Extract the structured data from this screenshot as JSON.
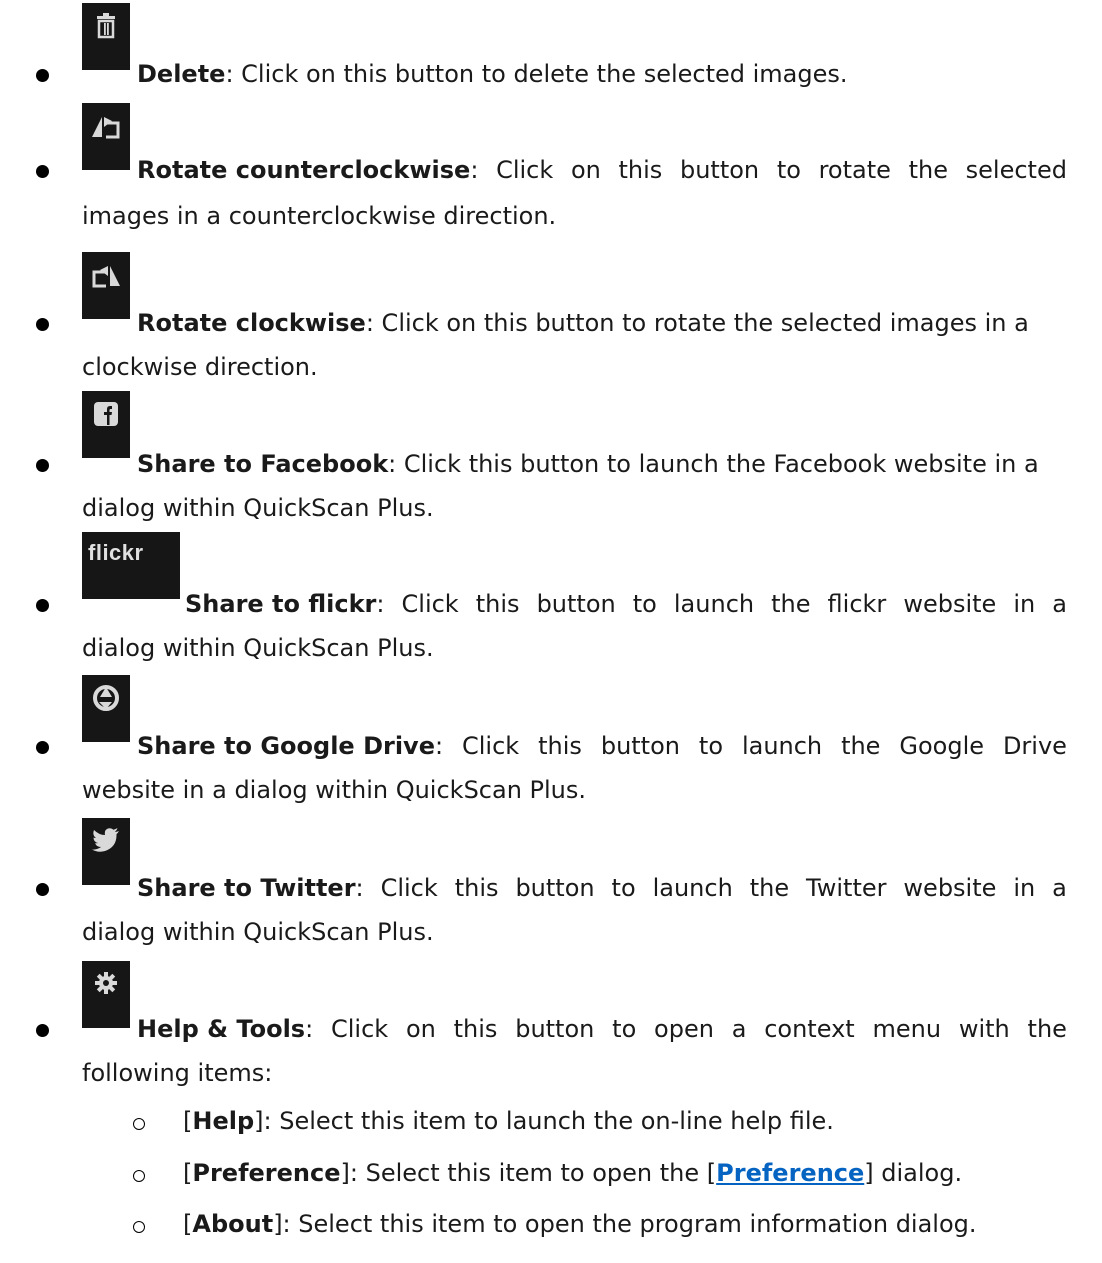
{
  "items": [
    {
      "icon": "trash-icon",
      "title": "Delete",
      "line1": ": Click on this button to delete the selected images.",
      "line2": ""
    },
    {
      "icon": "rotate-counterclockwise-icon",
      "title": "Rotate counterclockwise",
      "line1_words": [
        ":",
        "Click",
        "on",
        "this",
        "button",
        "to",
        "rotate",
        "the",
        "selected"
      ],
      "line2": "images in a counterclockwise direction."
    },
    {
      "icon": "rotate-clockwise-icon",
      "title": "Rotate clockwise",
      "line1": ": Click on this button to rotate the selected images in a",
      "line2": "clockwise direction."
    },
    {
      "icon": "facebook-icon",
      "title": "Share to Facebook",
      "line1": ": Click this button to launch the Facebook website in a",
      "line2": "dialog within QuickScan Plus."
    },
    {
      "icon": "flickr-icon",
      "icon_text": "flickr",
      "title": "Share to flickr",
      "line1_words": [
        ":",
        "Click",
        "this",
        "button",
        "to",
        "launch",
        "the",
        "flickr",
        "website",
        "in",
        "a"
      ],
      "line2": "dialog within QuickScan Plus."
    },
    {
      "icon": "google-drive-icon",
      "title": "Share to Google Drive",
      "line1_words": [
        ":",
        "Click",
        "this",
        "button",
        "to",
        "launch",
        "the",
        "Google",
        "Drive"
      ],
      "line2": "website in a dialog within QuickScan Plus."
    },
    {
      "icon": "twitter-icon",
      "title": "Share to Twitter",
      "line1_words": [
        ":",
        "Click",
        "this",
        "button",
        "to",
        "launch",
        "the",
        "Twitter",
        "website",
        "in",
        "a"
      ],
      "line2": "dialog within QuickScan Plus."
    },
    {
      "icon": "gear-icon",
      "title": "Help & Tools",
      "line1_words": [
        ":",
        "Click",
        "on",
        "this",
        "button",
        "to",
        "open",
        "a",
        "context",
        "menu",
        "with",
        "the"
      ],
      "line2": "following items:"
    }
  ],
  "subitems": [
    {
      "name": "Help",
      "text": "]: Select this item to launch the on-line help file."
    },
    {
      "name": "Preference",
      "text_a": "]: Select this item to open the [",
      "link": "Preference",
      "text_b": "] dialog."
    },
    {
      "name": "About",
      "text": "]: Select this item to open the program information dialog."
    }
  ],
  "colors": {
    "link": "#0563c1",
    "icon_bg": "#161616",
    "icon_fg": "#d9d9d9"
  }
}
